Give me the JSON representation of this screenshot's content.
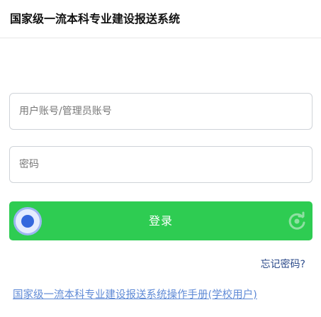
{
  "header": {
    "title": "国家级一流本科专业建设报送系统"
  },
  "login": {
    "username_placeholder": "用户账号/管理员账号",
    "password_placeholder": "密码",
    "captcha_label": "登录",
    "forgot_password": "忘记密码?",
    "manual_link": "国家级一流本科专业建设报送系统操作手册(学校用户)"
  },
  "colors": {
    "captcha_bg": "#2ecc52",
    "link": "#5f8ad6",
    "forgot": "#2b4a8a"
  },
  "icons": {
    "captcha_handle": "slider-handle-icon",
    "refresh": "refresh-icon"
  }
}
